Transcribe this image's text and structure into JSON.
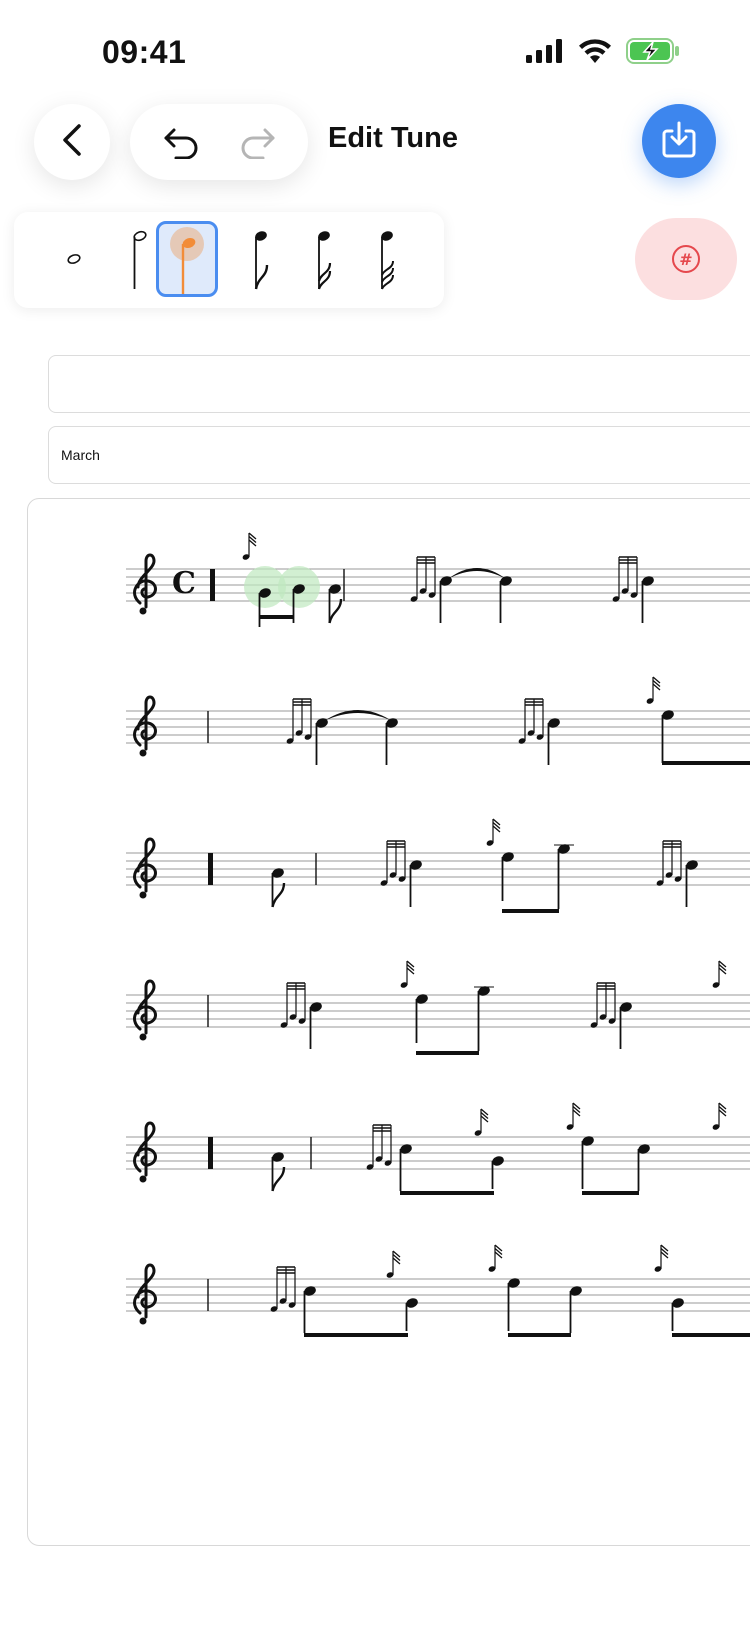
{
  "status_bar": {
    "time": "09:41",
    "icons": [
      "cellular-signal-icon",
      "wifi-icon",
      "battery-charging-icon"
    ]
  },
  "header": {
    "title": "Edit Tune",
    "buttons": [
      "back",
      "undo",
      "redo",
      "download"
    ]
  },
  "note_picker": {
    "options": [
      "whole-note",
      "half-note",
      "quarter-note",
      "eighth-note",
      "sixteenth-note",
      "thirty-second-note"
    ],
    "selected": "quarter-note"
  },
  "accidental_button": {
    "icon": "sharp-icon",
    "symbol": "#"
  },
  "fields": {
    "tune_name": {
      "value": "",
      "placeholder": ""
    },
    "tune_type": {
      "value": "March"
    }
  },
  "score": {
    "time_signature": "C",
    "staff_count": 6,
    "clef": "treble"
  },
  "colors": {
    "accent": "#3d86ee",
    "selected_note": "#f28c38",
    "sharp_bg": "#fcdfe0",
    "sharp_fg": "#e5484d",
    "highlight": "#bfe8bf"
  }
}
